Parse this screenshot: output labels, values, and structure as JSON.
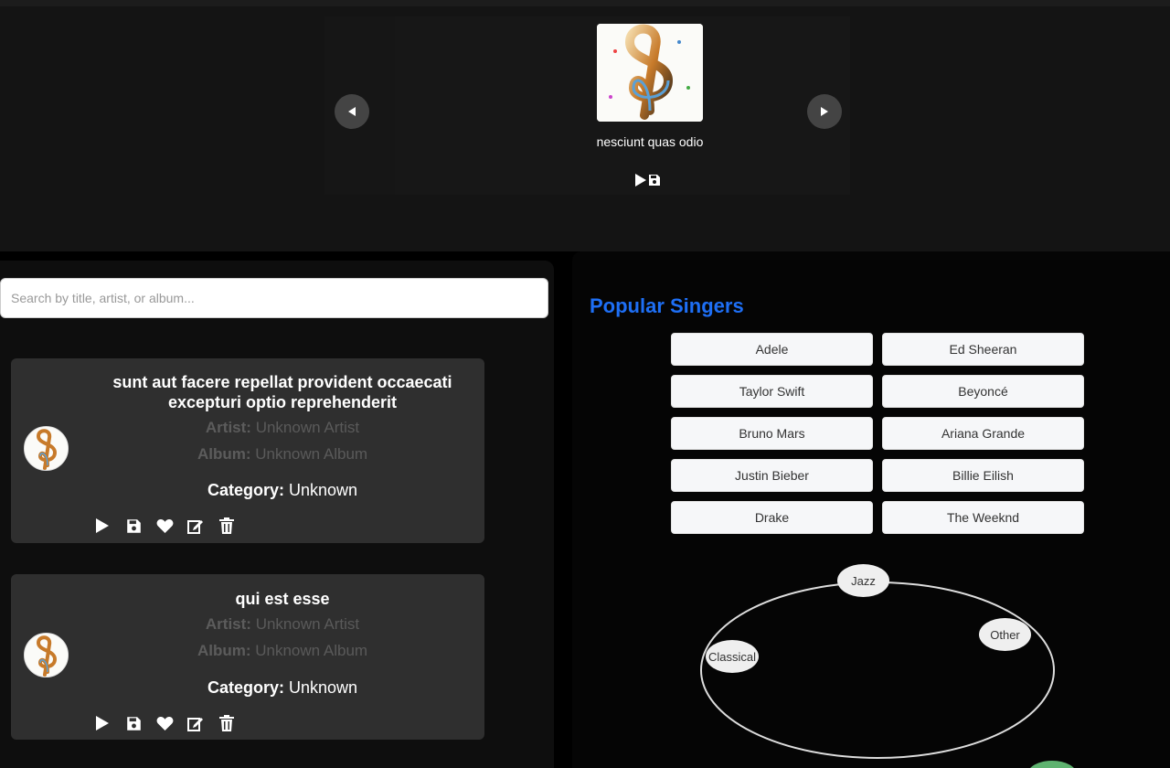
{
  "carousel": {
    "title": "nesciunt quas odio",
    "prev_icon": "triangle-left-icon",
    "next_icon": "triangle-right-icon"
  },
  "search": {
    "placeholder": "Search by title, artist, or album..."
  },
  "songs": [
    {
      "title": "sunt aut facere repellat provident occaecati excepturi optio reprehenderit",
      "artist_label": "Artist:",
      "artist": "Unknown Artist",
      "album_label": "Album:",
      "album": "Unknown Album",
      "category_label": "Category:",
      "category": "Unknown"
    },
    {
      "title": "qui est esse",
      "artist_label": "Artist:",
      "artist": "Unknown Artist",
      "album_label": "Album:",
      "album": "Unknown Album",
      "category_label": "Category:",
      "category": "Unknown"
    }
  ],
  "popular": {
    "title": "Popular Singers",
    "singers": [
      "Adele",
      "Ed Sheeran",
      "Taylor Swift",
      "Beyoncé",
      "Bruno Mars",
      "Ariana Grande",
      "Justin Bieber",
      "Billie Eilish",
      "Drake",
      "The Weeknd"
    ]
  },
  "genres": [
    "Jazz",
    "Other",
    "Classical"
  ],
  "colors": {
    "accent": "#1e6ff5",
    "card_bg": "#2f2f2f",
    "muted_text": "#5a5a5a"
  }
}
